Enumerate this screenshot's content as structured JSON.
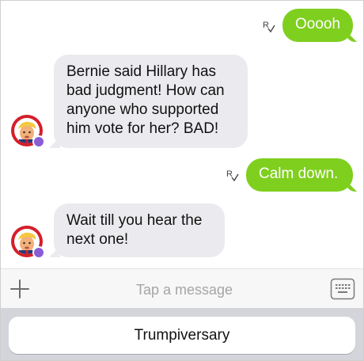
{
  "messages": [
    {
      "direction": "outgoing",
      "text": "Ooooh",
      "read_icon": "read-receipt-icon"
    },
    {
      "direction": "incoming",
      "lines": [
        "Bernie said Hillary has",
        "bad judgment! How can",
        "anyone who supported",
        "him vote for her? BAD!"
      ],
      "avatar": "trump-avatar-icon"
    },
    {
      "direction": "outgoing",
      "text": "Calm down.",
      "read_icon": "read-receipt-icon"
    },
    {
      "direction": "incoming",
      "lines": [
        "Wait till you hear the",
        "next one!"
      ],
      "avatar": "trump-avatar-icon"
    }
  ],
  "input": {
    "placeholder": "Tap a message",
    "value": "",
    "left_icon": "plus-icon",
    "right_icon": "keyboard-icon"
  },
  "suggestion": {
    "label": "Trumpiversary"
  },
  "colors": {
    "outgoing_bubble": "#7fcf1f",
    "incoming_bubble": "#ebebef",
    "avatar_ring": "#d41f2a",
    "status_dot": "#8a5cd6",
    "suggest_area_bg": "#d3d5da"
  }
}
